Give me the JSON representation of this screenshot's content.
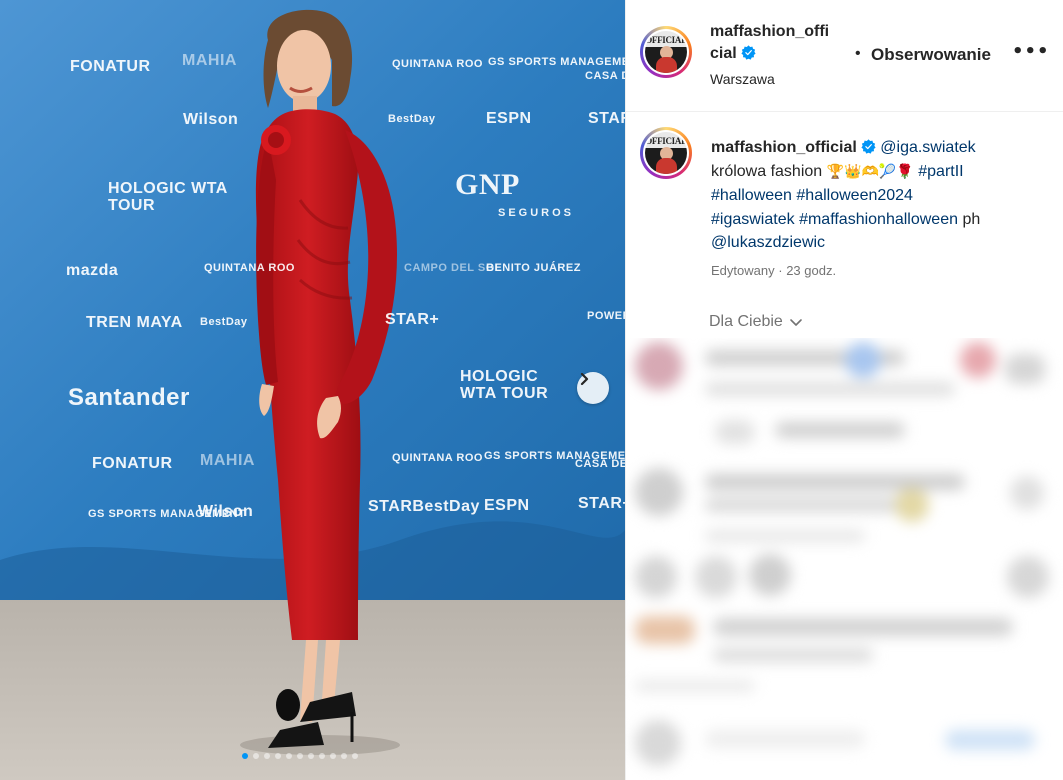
{
  "post": {
    "username_header": "maffashion_official",
    "location": "Warszawa",
    "follow_label": "Obserwowanie",
    "more_label": "•••",
    "separator": "•",
    "carousel": {
      "total": 11,
      "active": 1
    }
  },
  "photo_logos": [
    "FONATUR",
    "MAHIA",
    "QUINTANA ROO",
    "GS SPORTS MANAGEMENT",
    "CASA DEL SOL",
    "Wilson",
    "BestDay",
    "ESPN",
    "STAR+",
    "HOLOGIC WTA TOUR",
    "GNP",
    "SEGUROS",
    "mazda",
    "QUINTANA ROO",
    "CAMPO DEL SOL",
    "BENITO JUÁREZ",
    "TREN MAYA",
    "BestDay",
    "STAR+",
    "POWER",
    "Santander",
    "HOLOGIC WTA TOUR",
    "FONATUR",
    "MAHIA",
    "QUINTANA ROO",
    "GS SPORTS MANAGEMENT",
    "CASA DEL SOL",
    "GS SPORTS MANAGEMENT",
    "Wilson",
    "STARBestDay",
    "ESPN",
    "STAR+"
  ],
  "caption": {
    "username": "maffashion_official",
    "mention": "@iga.swiatek",
    "text": "królowa fashion",
    "emojis": "🏆👑🫶🎾🌹",
    "hashtags": [
      "#partII",
      "#halloween",
      "#halloween2024",
      "#igaswiatek",
      "#maffashionhalloween"
    ],
    "credit_prefix": "ph",
    "credit": "@lukaszdziewic"
  },
  "meta": {
    "edited": "Edytowany",
    "dot": "·",
    "time": "23 godz."
  },
  "for_you": "Dla Ciebie",
  "colors": {
    "link": "#00376b",
    "verified": "#0095f6",
    "backdrop": "#2f7fc2",
    "dress": "#c4161c",
    "floor": "#c4beb6"
  }
}
